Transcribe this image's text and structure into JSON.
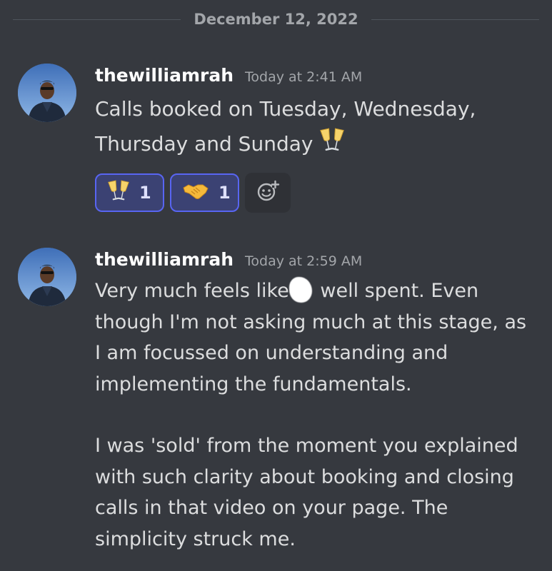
{
  "date_divider": "December 12, 2022",
  "messages": [
    {
      "username": "thewilliamrah",
      "timestamp": "Today at 2:41 AM",
      "text": "Calls booked on Tuesday, Wednesday, Thursday and Sunday",
      "inline_emoji": "clinking-glasses-icon",
      "reactions": [
        {
          "emoji": "clinking-glasses-icon",
          "count": "1"
        },
        {
          "emoji": "handshake-icon",
          "count": "1"
        }
      ],
      "add_reaction_icon": "add-reaction-icon"
    },
    {
      "username": "thewilliamrah",
      "timestamp": "Today at 2:59 AM",
      "paragraph_1_before": "Very much feels like",
      "paragraph_1_after": "well spent. Even though I'm not asking much at this stage, as I am focussed on understanding and implementing the fundamentals.",
      "paragraph_2": "I was 'sold' from the moment you explained with such clarity about booking and closing calls in that video on your page. The simplicity struck me."
    }
  ],
  "colors": {
    "background": "#36393f",
    "username": "#ffffff",
    "timestamp": "#a3a6aa",
    "text": "#dcddde",
    "reaction_border": "#5865f2",
    "reaction_bg": "#3b4273"
  }
}
